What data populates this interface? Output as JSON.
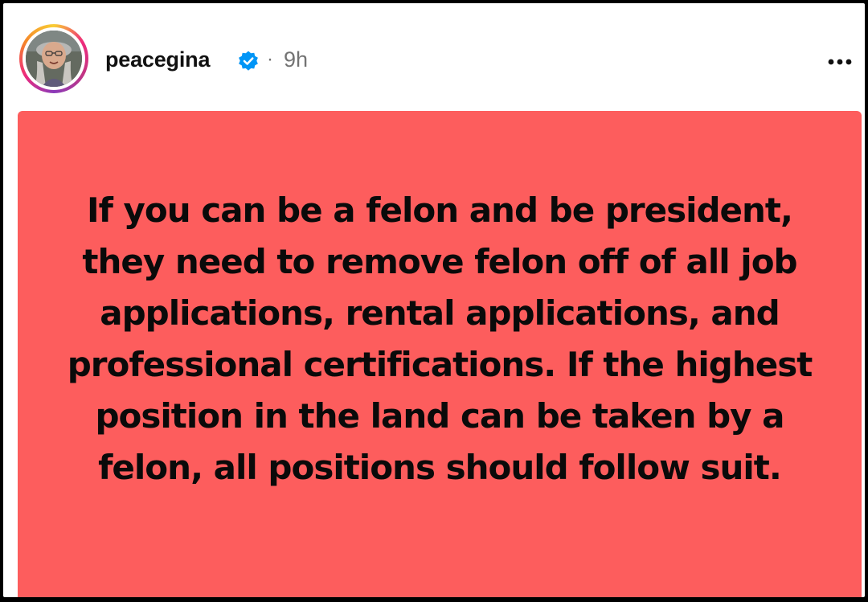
{
  "post": {
    "username": "peacegina",
    "separator": "·",
    "time_ago": "9h",
    "verified_icon": "verified-badge-icon",
    "more_icon": "more-options-icon",
    "avatar_icon": "profile-avatar",
    "text": "If you can be a felon and be president, they need to remove felon off of all job applications, rental applications, and professional certifications. If the highest position in the land can be taken by a felon, all positions should follow suit."
  },
  "colors": {
    "card_background": "#fd5d5d",
    "verified_blue": "#0095f6",
    "meta_gray": "#737373",
    "text": "#0a0a0a"
  }
}
